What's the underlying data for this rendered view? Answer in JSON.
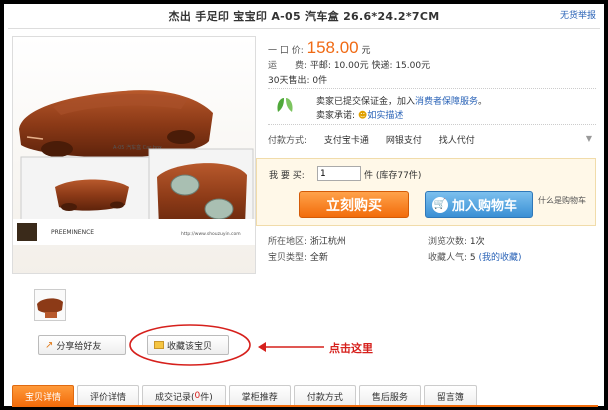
{
  "header": {
    "title": "杰出 手足印 宝宝印 A-05 汽车盒 26.6*24.2*7CM",
    "report_link": "无货举报"
  },
  "photo": {
    "caption": "A-05 汽车盒 Car box",
    "brand": "PREEMINENCE",
    "website": "http://www.shouzuyin.com"
  },
  "price": {
    "label": "一 口 价:",
    "value": "158.00",
    "unit": "元"
  },
  "shipping": {
    "label": "运　　费:",
    "text": "平邮: 10.00元 快递: 15.00元"
  },
  "sales": {
    "text": "30天售出: 0件"
  },
  "guarantee": {
    "line1_prefix": "卖家已提交保证金，加入",
    "line1_link": "消费者保障服务",
    "line1_suffix": "。",
    "line2_label": "卖家承诺:",
    "line2_link": "如实描述"
  },
  "payment": {
    "label": "付款方式:",
    "options": [
      "支付宝卡通",
      "网银支付",
      "找人代付"
    ]
  },
  "purchase": {
    "qty_label": "我 要 买:",
    "qty_value": "1",
    "qty_suffix": "件 (库存77件)",
    "buy_now": "立刻购买",
    "add_cart": "加入购物车",
    "whats_cart": "什么是购物车"
  },
  "details": {
    "location_label": "所在地区:",
    "location": "浙江杭州",
    "views_label": "浏览次数:",
    "views": "1次",
    "type_label": "宝贝类型:",
    "type": "全新",
    "popularity_label": "收藏人气:",
    "popularity": "5",
    "popularity_link": "(我的收藏)"
  },
  "actions": {
    "share": "分享给好友",
    "favorite": "收藏该宝贝",
    "annotation": "点击这里"
  },
  "tabs": [
    {
      "label": "宝贝详情"
    },
    {
      "label": "评价详情"
    },
    {
      "label_pre": "成交记录(",
      "label_num": "0",
      "label_post": "件)"
    },
    {
      "label": "掌柜推荐"
    },
    {
      "label": "付款方式"
    },
    {
      "label": "售后服务"
    },
    {
      "label": "留言簿"
    }
  ],
  "colors": {
    "price": "#f06a14",
    "link": "#2a63b7",
    "buy_now": "#f26c0b",
    "add_cart": "#3a8fd4",
    "annotation": "#d6201c"
  }
}
